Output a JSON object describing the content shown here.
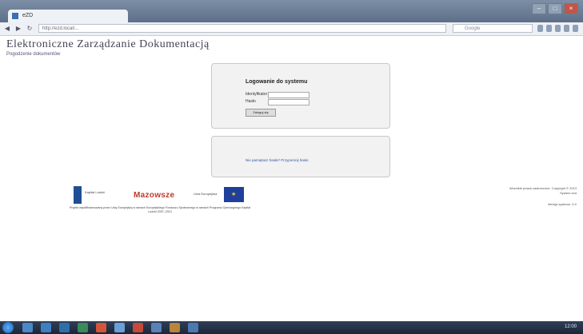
{
  "browser": {
    "tab_title": "eZD",
    "url": "http://ezd.local/...",
    "search_placeholder": "Google",
    "window_controls": [
      "–",
      "□",
      "×"
    ]
  },
  "site": {
    "title": "Elektroniczne Zarządzanie Dokumentacją",
    "subtitle": "Pogodzenie dokumentów"
  },
  "login": {
    "title": "Logowanie do systemu",
    "username_label": "Identyfikator",
    "password_label": "Hasło",
    "button_label": "Zaloguj się"
  },
  "help": {
    "link_text": "Nie pamiętasz hasła? Przypomnij hasło"
  },
  "footer": {
    "logo_kl": "Kapitał Ludzki",
    "logo_maz": "Mazowsze",
    "logo_ue": "Unia Europejska",
    "caption": "Projekt współfinansowany przez Unię Europejską w ramach Europejskiego Funduszu Społecznego w ramach Programu Operacyjnego Kapitał Ludzki 2007–2013",
    "right_line1": "Wszelkie prawa zastrzeżone. Copyright © 2013",
    "right_line2": "System ezd",
    "version": "Wersja systemu: 5.0"
  },
  "taskbar": {
    "tray_text": "12:00"
  },
  "colors": {
    "accent": "#3355aa",
    "brand_red": "#c0392b"
  }
}
